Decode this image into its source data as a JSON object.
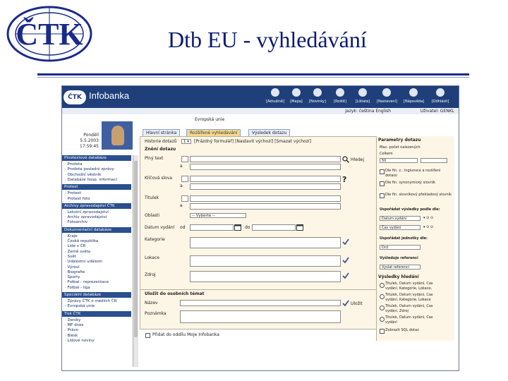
{
  "slide": {
    "logo_text": "ČTK",
    "title": "Dtb EU - vyhledávání"
  },
  "app": {
    "brand": "ČTK",
    "name": "Infobanka",
    "nav": [
      {
        "label": "[Aktuálně]",
        "icon": "megaphone-icon"
      },
      {
        "label": "[Mapa]",
        "icon": "map-icon"
      },
      {
        "label": "[Novinky]",
        "icon": "news-icon"
      },
      {
        "label": "[Roště]",
        "icon": "basket-icon"
      },
      {
        "label": "[Lištate]",
        "icon": "bookmark-icon"
      },
      {
        "label": "[Nastavení]",
        "icon": "settings-icon"
      },
      {
        "label": "[Nápověda]",
        "icon": "help-icon"
      },
      {
        "label": "[Odhlásit]",
        "icon": "close-icon"
      }
    ],
    "language": "Jazyk: čeština English",
    "user": "Uživatel: GENKL",
    "date_lines": [
      "Pondělí",
      "5.5.2003",
      "17:59:45"
    ],
    "top_link": "Evropská unie"
  },
  "sidebar": {
    "sections": [
      {
        "title": "Plnotextové databáze",
        "items": [
          "Prodota",
          "Prodota poslední zprávy",
          "Obchodní věstník",
          "Databáze hosp. informací"
        ]
      },
      {
        "title": "Protext",
        "items": [
          "Protext",
          "Protext foto"
        ]
      },
      {
        "title": "Archivy zpravodajství ČTK",
        "items": [
          "Letošní zpravodajství",
          "Archiv zpravodajství",
          "Fotoarchiv"
        ]
      },
      {
        "title": "Dokumentační databáze",
        "items": [
          "Kraje",
          "Česká republika",
          "Lidé v ČR",
          "Země světa",
          "Svět",
          "Událostní události",
          "Výroví",
          "Biografie",
          "Sporty",
          "Fotbal - reprezentace",
          "Fotbal - liga"
        ]
      },
      {
        "title": "Speciální databáze",
        "items": [
          "Zprávy ČTK o médiích ČR",
          "Evropská unie"
        ]
      },
      {
        "title": "Tisk ČTK",
        "items": [
          "Deníky",
          "MF dnes",
          "Právo",
          "Blesk",
          "Lidové noviny"
        ]
      }
    ]
  },
  "tabs": [
    "Hlavní stránka",
    "Rozšířené vyhledávání",
    "Výsledek dotazu"
  ],
  "form": {
    "history_label": "Historie dotazů",
    "history_value": "1 ▾",
    "history_links": "[Prázdný formulář] [Nastavit výchozí] [Smazat výchozí]",
    "query_heading": "Znění dotazu",
    "fields": [
      {
        "label": "Plný text",
        "op": "a"
      },
      {
        "label": "Klíčová slova",
        "op": "a"
      },
      {
        "label": "Titulek",
        "op": "a"
      }
    ],
    "hledej": "Hledej",
    "oblast_label": "Oblasti",
    "oblast_value": "-- Vyberte --",
    "datum_label": "Datum vydání",
    "od": "od",
    "do": "do",
    "kategorie_label": "Kategorie",
    "lokace_label": "Lokace",
    "zdroj_label": "Zdroj"
  },
  "save": {
    "heading": "Uložit do osobních témat",
    "nazev_label": "Název",
    "poznamka_label": "Poznámka",
    "ulozit": "Uložit",
    "infobanka_label": "Přidat do oddílu Moje Infobanka"
  },
  "right": {
    "params_heading": "Parametry dotazu",
    "max_label": "Max. počet nalezených",
    "celkem_label": "Celkem",
    "celkem_value": "50",
    "checks": [
      "Dle fin. z.: Inglunsce a rozšíření dotazu",
      "Dle fin. synonymický slovník",
      "Dle fin. slovníkový překladový slovník"
    ],
    "sort_heading": "Uspořádat výsledky podle dle:",
    "sort1": "Datum vydání",
    "sort2": "Čas vydání",
    "units_heading": "Uspořádat jednotky dle:",
    "units_value": "Drd",
    "ref_heading": "Vyšleduje referencí",
    "ref_value": "Vyslat referenci",
    "results_heading": "Výsledky hledání",
    "results": [
      "Titulek, Datum vydání, Čas vydání, Kategorie, Lokace, Zdroj",
      "Titulek, Datum vydání, Čas vydání, Kategorie, Lokace",
      "Titulek, Datum vydání, Čas vydání, Zdroj",
      "Titulek, Datum vydání, Čas vydání"
    ],
    "sql_label": "Zobrazit SQL dotaz"
  }
}
